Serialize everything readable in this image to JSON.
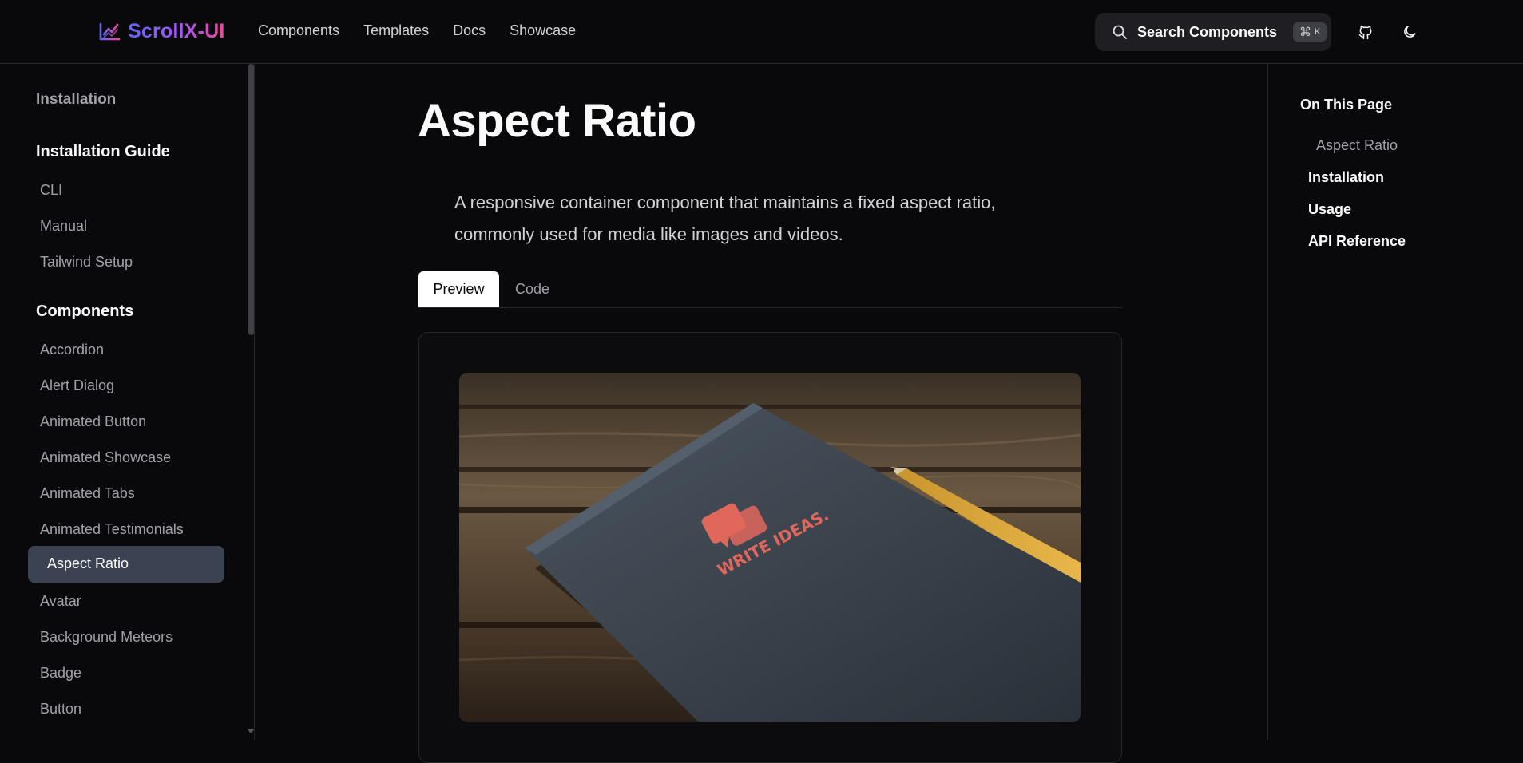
{
  "header": {
    "logo_text": "ScrollX-UI",
    "nav": [
      "Components",
      "Templates",
      "Docs",
      "Showcase"
    ],
    "search_label": "Search Components",
    "search_shortcut_symbol": "⌘",
    "search_shortcut_key": "K",
    "icons": [
      "github-icon",
      "moon-icon"
    ]
  },
  "sidebar": {
    "top_link": "Installation",
    "sections": [
      {
        "heading": "Installation Guide",
        "items": [
          "CLI",
          "Manual",
          "Tailwind Setup"
        ]
      },
      {
        "heading": "Components",
        "items": [
          "Accordion",
          "Alert Dialog",
          "Animated Button",
          "Animated Showcase",
          "Animated Tabs",
          "Animated Testimonials",
          "Aspect Ratio",
          "Avatar",
          "Background Meteors",
          "Badge",
          "Button"
        ]
      }
    ],
    "active_item": "Aspect Ratio"
  },
  "main": {
    "title": "Aspect Ratio",
    "description": "A responsive container component that maintains a fixed aspect ratio, commonly used for media like images and videos.",
    "tabs": [
      "Preview",
      "Code"
    ],
    "active_tab": "Preview",
    "preview_image": {
      "notebook_text": "WRITE IDEAS."
    }
  },
  "toc": {
    "title": "On This Page",
    "items": [
      {
        "label": "Aspect Ratio"
      },
      {
        "label": "Installation"
      },
      {
        "label": "Usage"
      },
      {
        "label": "API Reference"
      }
    ]
  },
  "colors": {
    "background": "#09090b",
    "border": "#27272a",
    "muted_text": "#a1a1aa",
    "active_item_bg": "#3b4252",
    "logo_gradient": [
      "#6366f1",
      "#a855f7",
      "#ec4899"
    ]
  }
}
